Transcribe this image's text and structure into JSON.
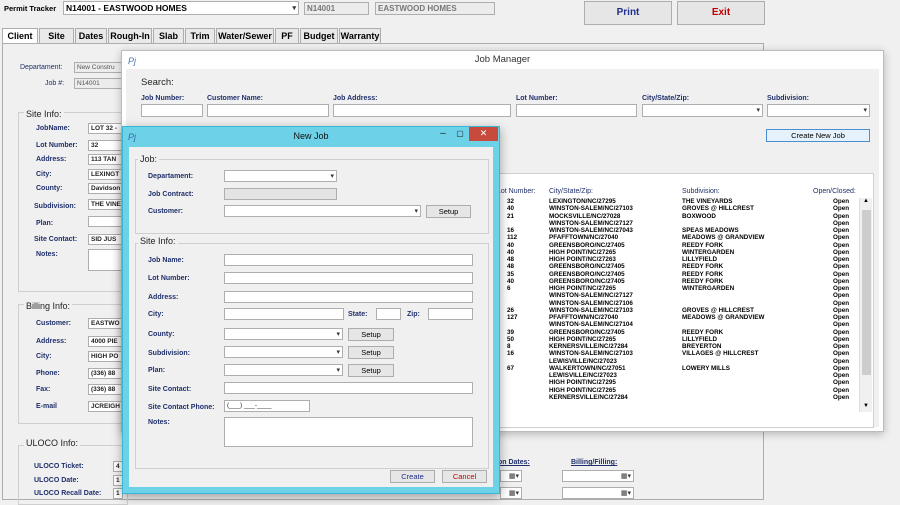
{
  "topbar": {
    "permit_label": "Permit Tracker",
    "permit_value": "N14001 - EASTWOOD HOMES",
    "job_code": "N14001",
    "builder": "EASTWOOD HOMES",
    "print": "Print",
    "exit": "Exit"
  },
  "tabs": [
    "Client",
    "Site",
    "Dates",
    "Rough-In",
    "Slab",
    "Trim",
    "Water/Sewer",
    "PF",
    "Budget",
    "Warranty"
  ],
  "client": {
    "department_label": "Departament:",
    "department_value": "New Constru",
    "job_label": "Job #:",
    "job_value": "N14001",
    "site_info": "Site Info:",
    "job_name_label": "JobName:",
    "job_name_value": "LOT 32 -",
    "lot_label": "Lot Number:",
    "lot_value": "32",
    "address_label": "Address:",
    "address_value": "113 TAN",
    "city_label": "City:",
    "city_value": "LEXINGT",
    "county_label": "County:",
    "county_value": "Davidson",
    "subdivision_label": "Subdivision:",
    "subdivision_value": "THE VINE",
    "plan_label": "Plan:",
    "site_contact_label": "Site Contact:",
    "site_contact_value": "SID JUS",
    "notes_label": "Notes:",
    "billing_info": "Billing Info:",
    "customer_label": "Customer:",
    "customer_value": "EASTWO",
    "address2_value": "4000 PIE",
    "city2_value": "HIGH PO",
    "phone_label": "Phone:",
    "phone_value": "(336) 88",
    "fax_label": "Fax:",
    "fax_value": "(336) 88",
    "email_label": "E-mail",
    "email_value": "JCREIGH",
    "uloco_info": "ULOCO Info:",
    "uloco_ticket": "ULOCO Ticket:",
    "uloco_date": "ULOCO Date:",
    "uloco_recall": "ULOCO Recall Date:",
    "uloco_ticket_value": "4",
    "uloco_date_value": "1",
    "uloco_recall_value": "1",
    "inspection_dates": "Inspection Dates:",
    "inspection_dates_vis": "ion Dates:",
    "billing_filling": "Billing/Filling:"
  },
  "job_manager": {
    "title": "Job Manager",
    "search": "Search:",
    "job_number": "Job Number:",
    "customer_name": "Customer Name:",
    "job_address": "Job Address:",
    "lot_number": "Lot Number:",
    "city_state_zip": "City/State/Zip:",
    "subdivision": "Subdivision:",
    "create": "Create New Job",
    "grid_headers": {
      "lot": "Lot Number:",
      "city": "City/State/Zip:",
      "subdivision": "Subdivision:",
      "open": "Open/Closed:"
    },
    "rows": [
      [
        "32",
        "LEXINGTON/NC/27295",
        "THE VINEYARDS",
        "Open"
      ],
      [
        "40",
        "WINSTON-SALEM/NC/27103",
        "GROVES @ HILLCREST",
        "Open"
      ],
      [
        "21",
        "MOCKSVILLE/NC/27028",
        "BOXWOOD",
        "Open"
      ],
      [
        "",
        "WINSTON-SALEM/NC/27127",
        "",
        "Open"
      ],
      [
        "16",
        "WINSTON-SALEM/NC/27043",
        "SPEAS MEADOWS",
        "Open"
      ],
      [
        "112",
        "PFAFFTOWN/NC/27040",
        "MEADOWS @ GRANDVIEW",
        "Open"
      ],
      [
        "40",
        "GREENSBORO/NC/27405",
        "REEDY FORK",
        "Open"
      ],
      [
        "40",
        "HIGH POINT/NC/27265",
        "WINTERGARDEN",
        "Open"
      ],
      [
        "48",
        "HIGH POINT/NC/27263",
        "LILLYFIELD",
        "Open"
      ],
      [
        "48",
        "GREENSBORO/NC/27405",
        "REEDY FORK",
        "Open"
      ],
      [
        "35",
        "GREENSBORO/NC/27405",
        "REEDY FORK",
        "Open"
      ],
      [
        "40",
        "GREENSBORO/NC/27405",
        "REEDY FORK",
        "Open"
      ],
      [
        "6",
        "HIGH POINT/NC/27265",
        "WINTERGARDEN",
        "Open"
      ],
      [
        "",
        "WINSTON-SALEM/NC/27127",
        "",
        "Open"
      ],
      [
        "",
        "WINSTON-SALEM/NC/27106",
        "",
        "Open"
      ],
      [
        "26",
        "WINSTON-SALEM/NC/27103",
        "GROVES @ HILLCREST",
        "Open"
      ],
      [
        "127",
        "PFAFFTOWN/NC/27040",
        "MEADOWS @ GRANDVIEW",
        "Open"
      ],
      [
        "",
        "WINSTON-SALEM/NC/27104",
        "",
        "Open"
      ],
      [
        "39",
        "GREENSBORO/NC/27405",
        "REEDY FORK",
        "Open"
      ],
      [
        "50",
        "HIGH POINT/NC/27265",
        "LILLYFIELD",
        "Open"
      ],
      [
        "8",
        "KERNERSVILLE/NC/27284",
        "BREYERTON",
        "Open"
      ],
      [
        "16",
        "WINSTON-SALEM/NC/27103",
        "VILLAGES @ HILLCREST",
        "Open"
      ],
      [
        "",
        "LEWISVILLE/NC/27023",
        "",
        "Open"
      ],
      [
        "67",
        "WALKERTOWN/NC/27051",
        "LOWERY MILLS",
        "Open"
      ],
      [
        "",
        "LEWISVILLE/NC/27023",
        "",
        "Open"
      ],
      [
        "",
        "HIGH POINT/NC/27295",
        "",
        "Open"
      ],
      [
        "",
        "HIGH POINT/NC/27265",
        "",
        "Open"
      ],
      [
        "",
        "KERNERSVILLE/NC/27284",
        "",
        "Open"
      ]
    ]
  },
  "new_job": {
    "title": "New Job",
    "job": "Job:",
    "department": "Departament:",
    "job_contract": "Job Contract:",
    "customer": "Customer:",
    "setup": "Setup",
    "site_info": "Site Info:",
    "job_name": "Job Name:",
    "lot_number": "Lot Number:",
    "address": "Address:",
    "city": "City:",
    "state": "State:",
    "zip": "Zip:",
    "county": "County:",
    "subdivision": "Subdivision:",
    "plan": "Plan:",
    "site_contact": "Site Contact:",
    "site_contact_phone": "Site Contact Phone:",
    "phone_mask": "(___) ___-____",
    "notes": "Notes:",
    "create": "Create",
    "cancel": "Cancel"
  }
}
